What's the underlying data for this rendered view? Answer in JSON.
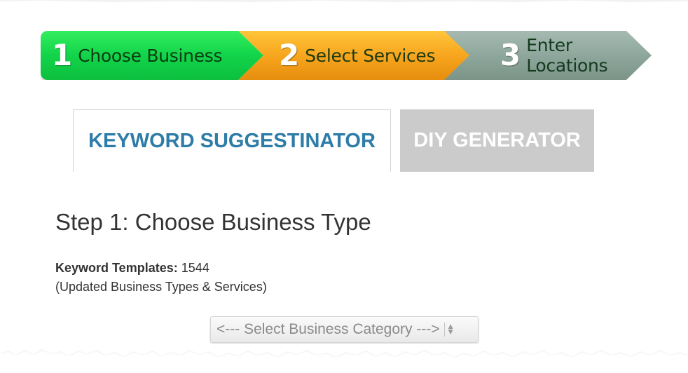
{
  "steps": [
    {
      "number": "1",
      "label": "Choose Business",
      "color": "#12d44a"
    },
    {
      "number": "2",
      "label": "Select Services",
      "color": "#f6a31c"
    },
    {
      "number": "3",
      "label": "Enter Locations",
      "color": "#8ea79c"
    }
  ],
  "tabs": {
    "keyword_label": "KEYWORD SUGGESTINATOR",
    "diy_label": "DIY GENERATOR"
  },
  "main": {
    "heading": "Step 1: Choose Business Type",
    "templates_key": "Keyword Templates:",
    "templates_value": "1544",
    "note": "(Updated Business Types & Services)"
  },
  "category_select": {
    "selected": "<--- Select Business Category --->"
  },
  "colors": {
    "tab_active_text": "#2e7ca8",
    "tab_inactive_bg": "#cbcbcb"
  }
}
